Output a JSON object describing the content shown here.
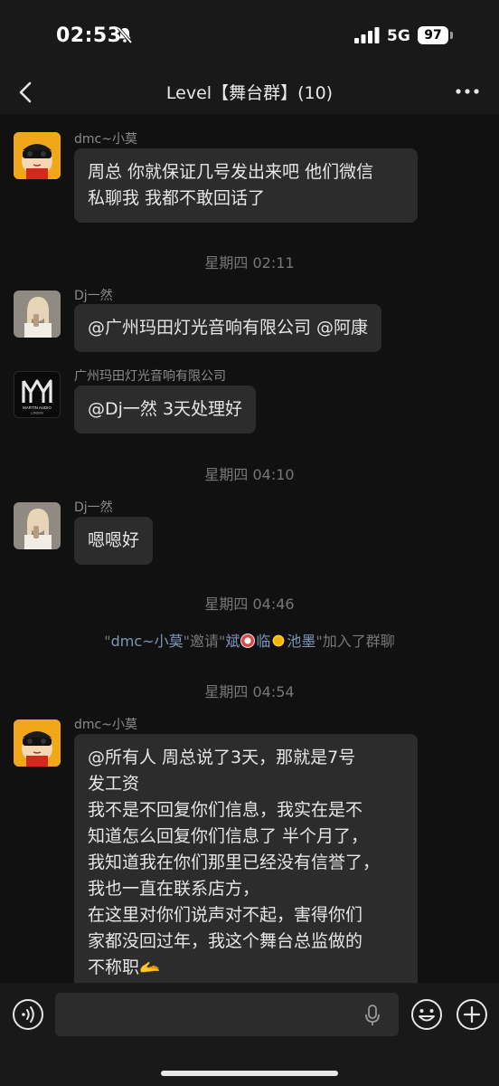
{
  "status": {
    "time": "02:53",
    "network": "5G",
    "battery": "97"
  },
  "header": {
    "title": "Level【舞台群】(10)"
  },
  "messages": [
    {
      "sender": "dmc~小莫",
      "lines": [
        "周总 你就保证几号发出来吧 他们微信",
        "私聊我 我都不敢回话了"
      ]
    },
    {
      "timestamp": "星期四 02:11"
    },
    {
      "sender": "Dj一然",
      "lines": [
        "@广州玛田灯光音响有限公司 @阿康"
      ]
    },
    {
      "sender": "广州玛田灯光音响有限公司",
      "lines": [
        "@Dj一然 3天处理好"
      ],
      "avatar_logo": "MARTIN AUDIO",
      "avatar_logo_sub": "LONDON"
    },
    {
      "timestamp": "星期四 04:10"
    },
    {
      "sender": "Dj一然",
      "lines": [
        "嗯嗯好"
      ]
    },
    {
      "timestamp": "星期四 04:46"
    },
    {
      "system": {
        "prefix": "\"",
        "inviter": "dmc~小莫",
        "mid1": "\"邀请\"",
        "invitee_a": "斌",
        "invitee_b": "临",
        "invitee_c": "池墨",
        "suffix": "\"加入了群聊"
      }
    },
    {
      "timestamp": "星期四 04:54"
    },
    {
      "sender": "dmc~小莫",
      "lines": [
        "@所有人 周总说了3天，那就是7号",
        "发工资",
        "我不是不回复你们信息，我实在是不",
        "知道怎么回复你们信息了 半个月了，",
        "我知道我在你们那里已经没有信誉了，",
        "我也一直在联系店方，",
        "在这里对你们说声对不起，害得你们",
        "家都没回过年，我这个舞台总监做的",
        "不称职🫴"
      ]
    }
  ],
  "colors": {
    "background": "#111111",
    "bar": "#191919",
    "bubble": "#2c2c2c",
    "link_name": "#7f95bd"
  }
}
